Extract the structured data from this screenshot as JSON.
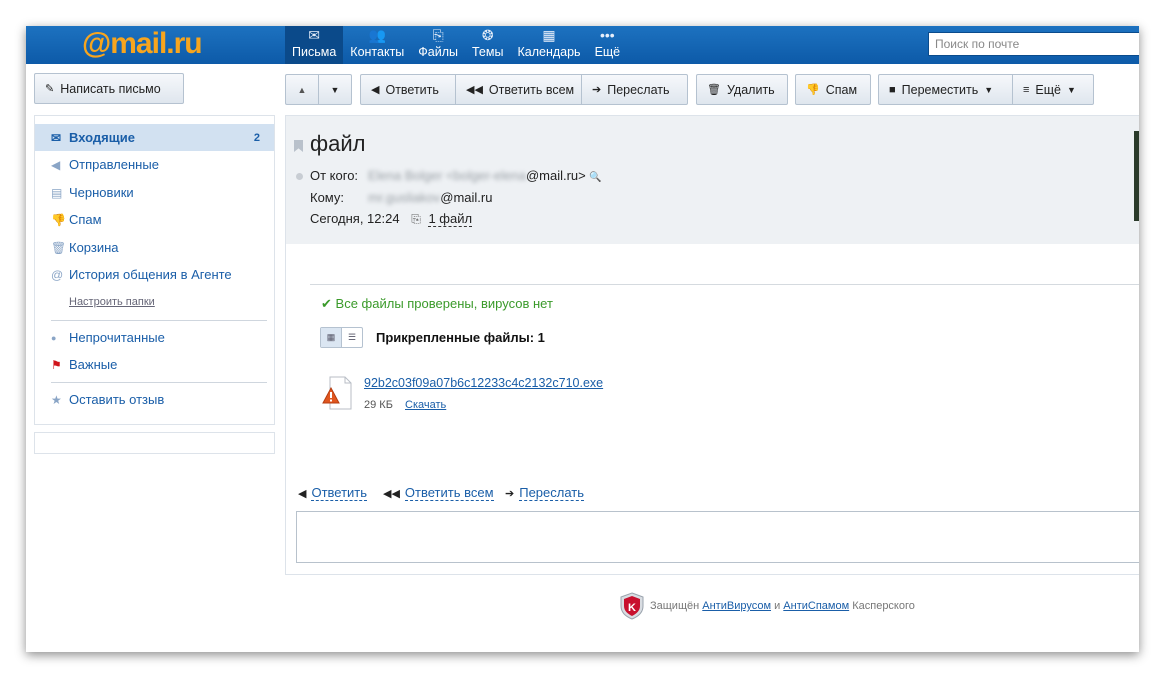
{
  "header": {
    "logo": "@mail.ru",
    "nav": [
      {
        "label": "Письма",
        "icon": "envelope-icon",
        "glyph": "✉"
      },
      {
        "label": "Контакты",
        "icon": "contacts-icon",
        "glyph": "👥"
      },
      {
        "label": "Файлы",
        "icon": "paperclip-icon",
        "glyph": "⎘"
      },
      {
        "label": "Темы",
        "icon": "palette-icon",
        "glyph": "❂"
      },
      {
        "label": "Календарь",
        "icon": "calendar-icon",
        "glyph": "▦"
      },
      {
        "label": "Ещё",
        "icon": "more-dots-icon",
        "glyph": "•••"
      }
    ],
    "search_placeholder": "Поиск по почте"
  },
  "toolbar": {
    "compose": "Написать письмо",
    "reply": "Ответить",
    "reply_all": "Ответить всем",
    "forward": "Переслать",
    "delete": "Удалить",
    "spam": "Спам",
    "move": "Переместить",
    "more": "Ещё"
  },
  "sidebar": {
    "folders": [
      {
        "label": "Входящие",
        "icon": "inbox-icon",
        "count": "2",
        "active": true
      },
      {
        "label": "Отправленные",
        "icon": "sent-icon"
      },
      {
        "label": "Черновики",
        "icon": "drafts-icon"
      },
      {
        "label": "Спам",
        "icon": "spam-icon"
      },
      {
        "label": "Корзина",
        "icon": "trash-icon"
      },
      {
        "label": "История общения в Агенте",
        "icon": "agent-icon"
      }
    ],
    "configure": "Настроить папки",
    "filters": [
      {
        "label": "Непрочитанные",
        "icon": "unread-dot-icon"
      },
      {
        "label": "Важные",
        "icon": "important-flag-icon"
      }
    ],
    "feedback": "Оставить отзыв"
  },
  "message": {
    "subject": "файл",
    "from_label": "От кого:",
    "from_name": "Elena Bolger",
    "from_addr_prefix": "<bolger-elena",
    "from_addr_suffix": "@mail.ru>",
    "to_label": "Кому:",
    "to_prefix": "mr.gusliakov",
    "to_suffix": "@mail.ru",
    "date": "Сегодня, 12:24",
    "attach_link": "1 файл",
    "virus_check": "Все файлы проверены, вирусов нет",
    "attachments_title": "Прикрепленные файлы: 1",
    "file_name": "92b2c03f09a07b6c12233c4c2132c710.exe",
    "file_size": "29 КБ",
    "download": "Скачать",
    "quick_reply": "Ответить",
    "quick_reply_all": "Ответить всем",
    "quick_forward": "Переслать"
  },
  "footer": {
    "prefix": "Защищён",
    "antivirus": "АнтиВирусом",
    "and": "и",
    "antispam": "АнтиСпамом",
    "suffix": "Касперского"
  },
  "colors": {
    "header_blue": "#1565b3",
    "logo_orange": "#f7a51e",
    "link_blue": "#1a5ea8",
    "ok_green": "#3a9a2a"
  }
}
